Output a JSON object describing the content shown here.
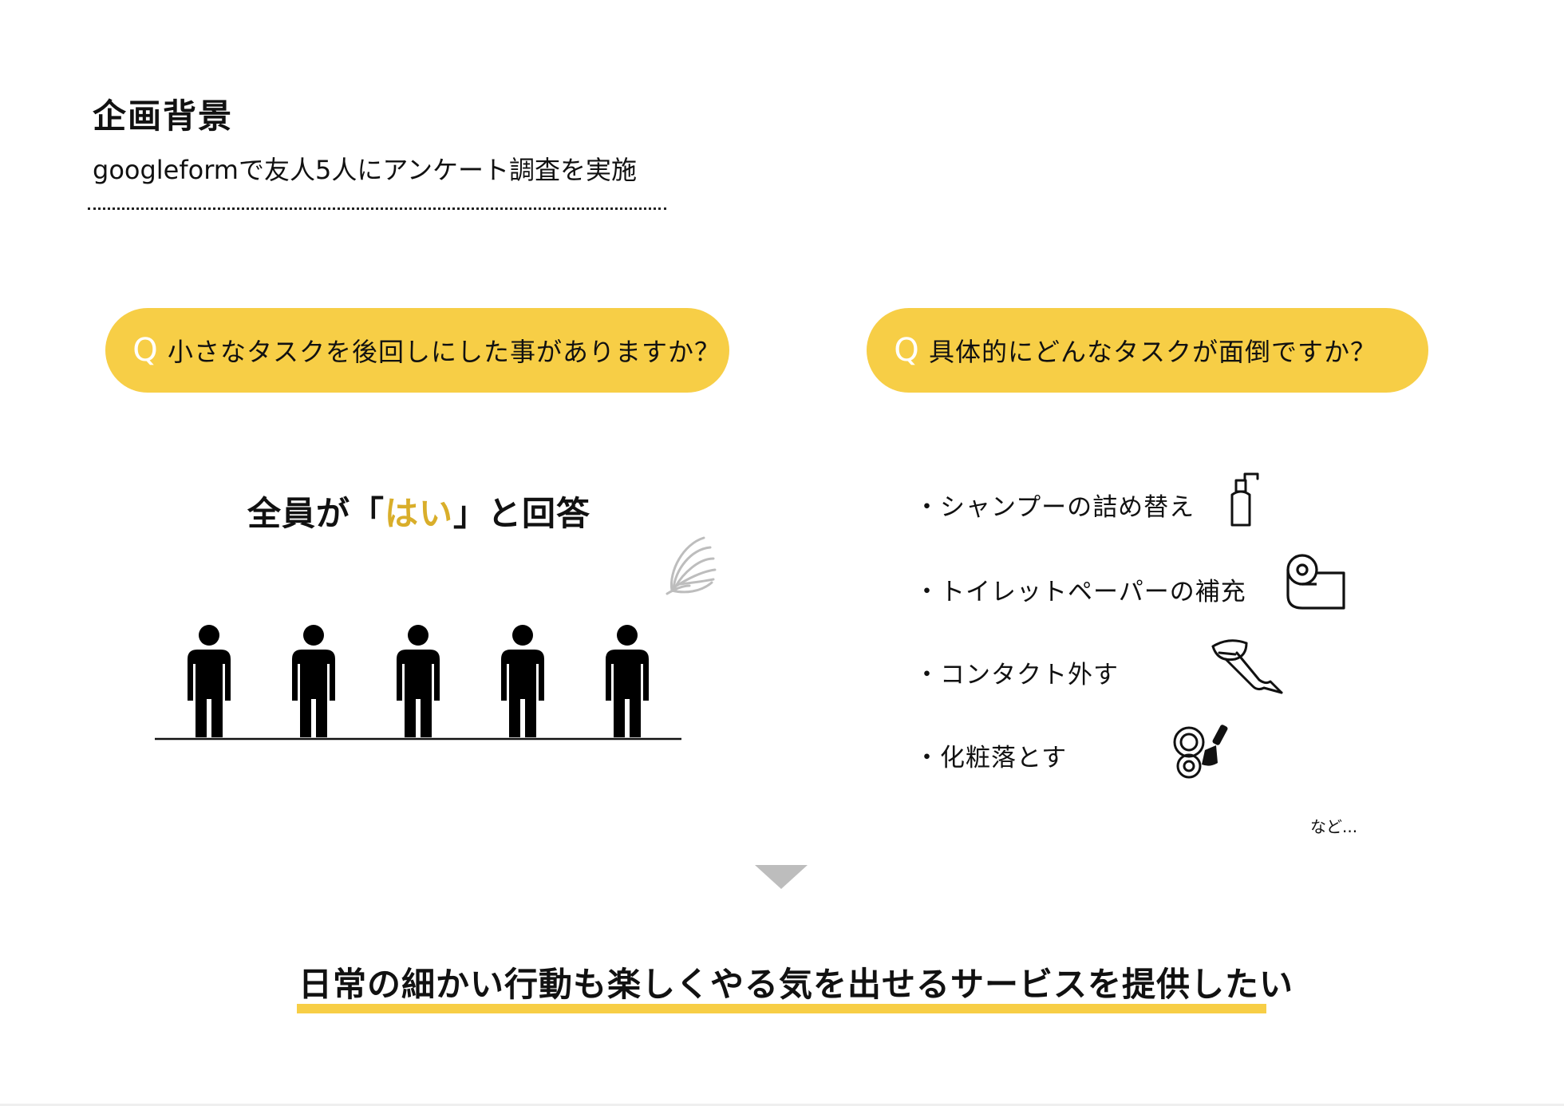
{
  "header": {
    "title": "企画背景",
    "subtitle": "googleformで友人5人にアンケート調査を実施"
  },
  "left_question": {
    "q_mark": "Q",
    "text": "小さなタスクを後回しにした事がありますか？"
  },
  "right_question": {
    "q_mark": "Q",
    "text": "具体的にどんなタスクが面倒ですか？"
  },
  "answer": {
    "prefix": "全員が「",
    "highlight": "はい",
    "suffix": "」と回答",
    "highlight_color": "#D9AE2A"
  },
  "tasks": [
    {
      "label": "・シャンプーの詰め替え",
      "icon": "shampoo-bottle-icon"
    },
    {
      "label": "・トイレットペーパーの補充",
      "icon": "toilet-paper-icon"
    },
    {
      "label": "・コンタクト外す",
      "icon": "contact-lens-icon"
    },
    {
      "label": "・化粧落とす",
      "icon": "makeup-compact-icon"
    }
  ],
  "etc_note": "など...",
  "conclusion": "日常の細かい行動も楽しくやる気を出せるサービスを提供したい",
  "colors": {
    "accent_yellow": "#F7CE46",
    "arrow_gray": "#BDBDBD"
  },
  "people_count": 5
}
